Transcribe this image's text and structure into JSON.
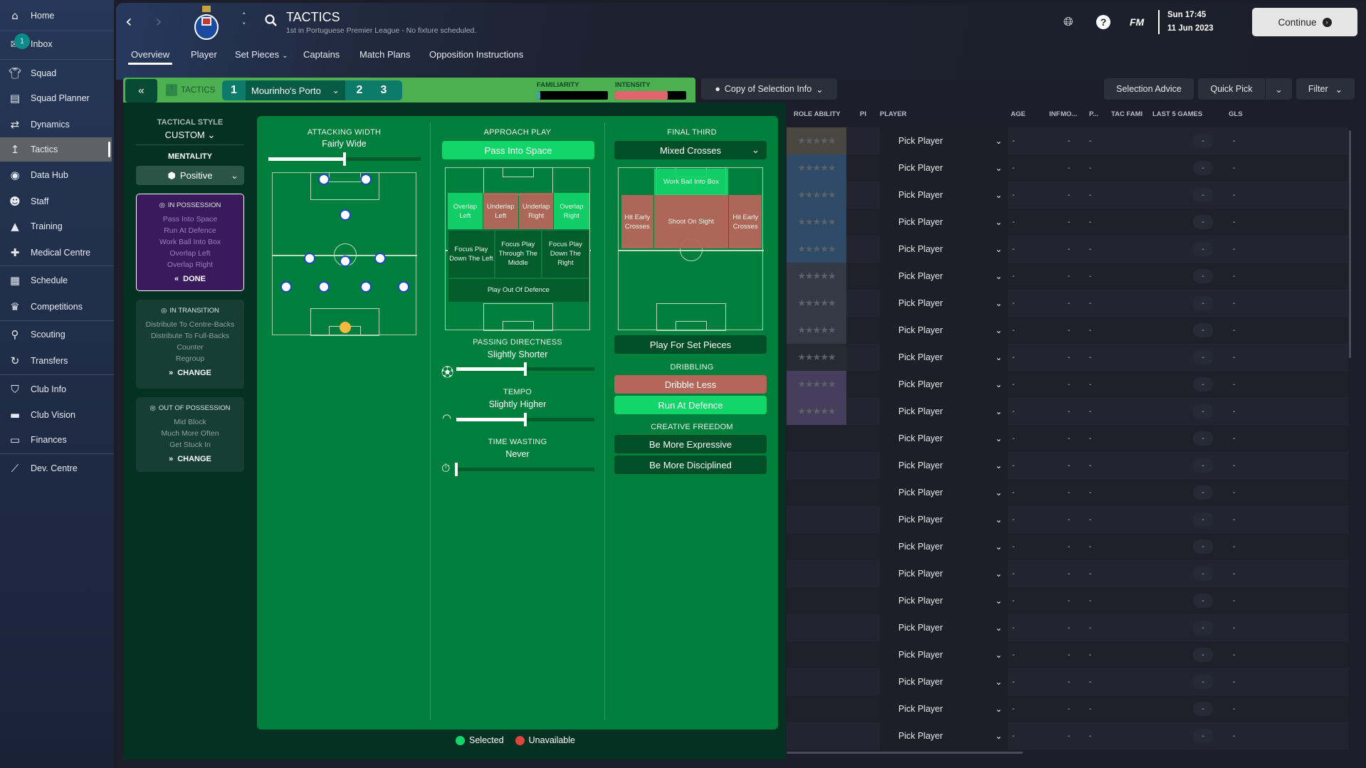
{
  "sidebar": {
    "items": [
      {
        "label": "Home",
        "icon": "home-icon"
      },
      {
        "label": "Inbox",
        "icon": "inbox-icon",
        "badge": "1"
      },
      {
        "label": "Squad",
        "icon": "shirt-icon"
      },
      {
        "label": "Squad Planner",
        "icon": "clipboard-icon"
      },
      {
        "label": "Dynamics",
        "icon": "dynamics-icon"
      },
      {
        "label": "Tactics",
        "icon": "tactics-icon",
        "active": true
      },
      {
        "label": "Data Hub",
        "icon": "data-hub-icon"
      },
      {
        "label": "Staff",
        "icon": "staff-icon"
      },
      {
        "label": "Training",
        "icon": "training-icon"
      },
      {
        "label": "Medical Centre",
        "icon": "medical-icon"
      },
      {
        "label": "Schedule",
        "icon": "calendar-icon"
      },
      {
        "label": "Competitions",
        "icon": "trophy-icon"
      },
      {
        "label": "Scouting",
        "icon": "search-icon"
      },
      {
        "label": "Transfers",
        "icon": "transfers-icon"
      },
      {
        "label": "Club Info",
        "icon": "shield-icon"
      },
      {
        "label": "Club Vision",
        "icon": "briefcase-icon"
      },
      {
        "label": "Finances",
        "icon": "money-icon"
      },
      {
        "label": "Dev. Centre",
        "icon": "dev-centre-icon"
      }
    ]
  },
  "header": {
    "title": "TACTICS",
    "subtitle": "1st in Portuguese Premier League - No fixture scheduled.",
    "fm_label": "FM",
    "time": "Sun 17:45",
    "date": "11 Jun 2023",
    "continue_label": "Continue"
  },
  "tabs": [
    {
      "label": "Overview",
      "active": true
    },
    {
      "label": "Player"
    },
    {
      "label": "Set Pieces",
      "dropdown": true
    },
    {
      "label": "Captains"
    },
    {
      "label": "Match Plans"
    },
    {
      "label": "Opposition Instructions"
    }
  ],
  "tactics_bar": {
    "label": "TACTICS",
    "slots": [
      "1",
      "2",
      "3"
    ],
    "tactic_name": "Mourinho's Porto",
    "familiarity_label": "FAMILIARITY",
    "familiarity": 0.05,
    "intensity_label": "INTENSITY",
    "intensity": 0.74
  },
  "selection": {
    "copy_label": "Copy of Selection Info",
    "advice_label": "Selection Advice",
    "quick_pick_label": "Quick Pick",
    "filter_label": "Filter"
  },
  "style": {
    "title": "TACTICAL STYLE",
    "value": "CUSTOM",
    "mentality_label": "MENTALITY",
    "mentality": "Positive"
  },
  "phases": [
    {
      "title": "IN POSSESSION",
      "lines": [
        "Pass Into Space",
        "Run At Defence",
        "Work Ball Into Box",
        "Overlap Left",
        "Overlap Right"
      ],
      "action": "DONE"
    },
    {
      "title": "IN TRANSITION",
      "lines": [
        "Distribute To Centre-Backs",
        "Distribute To Full-Backs",
        "Counter",
        "Regroup"
      ],
      "action": "CHANGE"
    },
    {
      "title": "OUT OF POSSESSION",
      "lines": [
        "Mid Block",
        "Much More Often",
        "Get Stuck In"
      ],
      "action": "CHANGE"
    }
  ],
  "attacking_width": {
    "label": "ATTACKING WIDTH",
    "value": "Fairly Wide",
    "level": 0.5
  },
  "approach": {
    "label": "APPROACH PLAY",
    "selected": "Pass Into Space",
    "zones": [
      {
        "label": "Overlap Left",
        "state": "selected"
      },
      {
        "label": "Underlap Left",
        "state": "unavailable"
      },
      {
        "label": "Underlap Right",
        "state": "unavailable"
      },
      {
        "label": "Overlap Right",
        "state": "selected"
      },
      {
        "label": "Focus Play Down The Left",
        "state": "none"
      },
      {
        "label": "Focus Play Through The Middle",
        "state": "none"
      },
      {
        "label": "Focus Play Down The Right",
        "state": "none"
      },
      {
        "label": "Play Out Of Defence",
        "state": "none"
      }
    ]
  },
  "passing_directness": {
    "label": "PASSING DIRECTNESS",
    "value": "Slightly Shorter",
    "level": 0.5
  },
  "tempo": {
    "label": "TEMPO",
    "value": "Slightly Higher",
    "level": 0.5
  },
  "time_wasting": {
    "label": "TIME WASTING",
    "value": "Never",
    "level": 0
  },
  "final_third": {
    "label": "FINAL THIRD",
    "selected": "Mixed Crosses",
    "zones": [
      {
        "label": "Work Ball Into Box",
        "state": "selected"
      },
      {
        "label": "Hit Early Crosses",
        "state": "unavailable"
      },
      {
        "label": "Shoot On Sight",
        "state": "unavailable"
      },
      {
        "label": "Hit Early Crosses",
        "state": "unavailable"
      }
    ],
    "set_pieces": "Play For Set Pieces"
  },
  "dribbling": {
    "label": "DRIBBLING",
    "options": [
      {
        "label": "Dribble Less",
        "state": "unavailable"
      },
      {
        "label": "Run At Defence",
        "state": "selected"
      }
    ]
  },
  "creative_freedom": {
    "label": "CREATIVE FREEDOM",
    "options": [
      {
        "label": "Be More Expressive",
        "state": "none"
      },
      {
        "label": "Be More Disciplined",
        "state": "none"
      }
    ]
  },
  "legend": {
    "selected": "Selected",
    "unavailable": "Unavailable"
  },
  "colors": {
    "selected": "#12d66a",
    "unavailable": "#b5665a",
    "in_possession": "#3a1a5c",
    "goalkeeper": "#f5b942"
  },
  "table": {
    "columns": [
      "ROLE ABILITY",
      "PI",
      "PLAYER",
      "AGE",
      "INF",
      "MO...",
      "P...",
      "TAC FAMI",
      "LAST 5 GAMES",
      "GLS"
    ],
    "rows": [
      {
        "player": "Pick Player",
        "age": "-",
        "mo": "-",
        "p": "-",
        "last5": "-",
        "gls": "-",
        "band": "#4a4640",
        "stars": 0
      },
      {
        "player": "Pick Player",
        "age": "-",
        "mo": "-",
        "p": "-",
        "last5": "-",
        "gls": "-",
        "band": "#2d4b66",
        "stars": 0
      },
      {
        "player": "Pick Player",
        "age": "-",
        "mo": "-",
        "p": "-",
        "last5": "-",
        "gls": "-",
        "band": "#2d4b66",
        "stars": 0
      },
      {
        "player": "Pick Player",
        "age": "-",
        "mo": "-",
        "p": "-",
        "last5": "-",
        "gls": "-",
        "band": "#2d4b66",
        "stars": 0
      },
      {
        "player": "Pick Player",
        "age": "-",
        "mo": "-",
        "p": "-",
        "last5": "-",
        "gls": "-",
        "band": "#2d4b66",
        "stars": 0
      },
      {
        "player": "Pick Player",
        "age": "-",
        "mo": "-",
        "p": "-",
        "last5": "-",
        "gls": "-",
        "band": "#343a43",
        "stars": 0
      },
      {
        "player": "Pick Player",
        "age": "-",
        "mo": "-",
        "p": "-",
        "last5": "-",
        "gls": "-",
        "band": "#343a43",
        "stars": 0
      },
      {
        "player": "Pick Player",
        "age": "-",
        "mo": "-",
        "p": "-",
        "last5": "-",
        "gls": "-",
        "band": "#343a43",
        "stars": 0
      },
      {
        "player": "Pick Player",
        "age": "-",
        "mo": "-",
        "p": "-",
        "last5": "-",
        "gls": "-",
        "band": "#262a33",
        "stars": 0
      },
      {
        "player": "Pick Player",
        "age": "-",
        "mo": "-",
        "p": "-",
        "last5": "-",
        "gls": "-",
        "band": "#453e5c",
        "stars": 0
      },
      {
        "player": "Pick Player",
        "age": "-",
        "mo": "-",
        "p": "-",
        "last5": "-",
        "gls": "-",
        "band": "#453e5c",
        "stars": 0
      },
      {
        "player": "Pick Player",
        "age": "-",
        "mo": "-",
        "p": "-",
        "last5": "-",
        "gls": "-"
      },
      {
        "player": "Pick Player",
        "age": "-",
        "mo": "-",
        "p": "-",
        "last5": "-",
        "gls": "-"
      },
      {
        "player": "Pick Player",
        "age": "-",
        "mo": "-",
        "p": "-",
        "last5": "-",
        "gls": "-"
      },
      {
        "player": "Pick Player",
        "age": "-",
        "mo": "-",
        "p": "-",
        "last5": "-",
        "gls": "-"
      },
      {
        "player": "Pick Player",
        "age": "-",
        "mo": "-",
        "p": "-",
        "last5": "-",
        "gls": "-"
      },
      {
        "player": "Pick Player",
        "age": "-",
        "mo": "-",
        "p": "-",
        "last5": "-",
        "gls": "-"
      },
      {
        "player": "Pick Player",
        "age": "-",
        "mo": "-",
        "p": "-",
        "last5": "-",
        "gls": "-"
      },
      {
        "player": "Pick Player",
        "age": "-",
        "mo": "-",
        "p": "-",
        "last5": "-",
        "gls": "-"
      },
      {
        "player": "Pick Player",
        "age": "-",
        "mo": "-",
        "p": "-",
        "last5": "-",
        "gls": "-"
      },
      {
        "player": "Pick Player",
        "age": "-",
        "mo": "-",
        "p": "-",
        "last5": "-",
        "gls": "-"
      },
      {
        "player": "Pick Player",
        "age": "-",
        "mo": "-",
        "p": "-",
        "last5": "-",
        "gls": "-"
      },
      {
        "player": "Pick Player",
        "age": "-",
        "mo": "-",
        "p": "-",
        "last5": "-",
        "gls": "-"
      }
    ]
  }
}
